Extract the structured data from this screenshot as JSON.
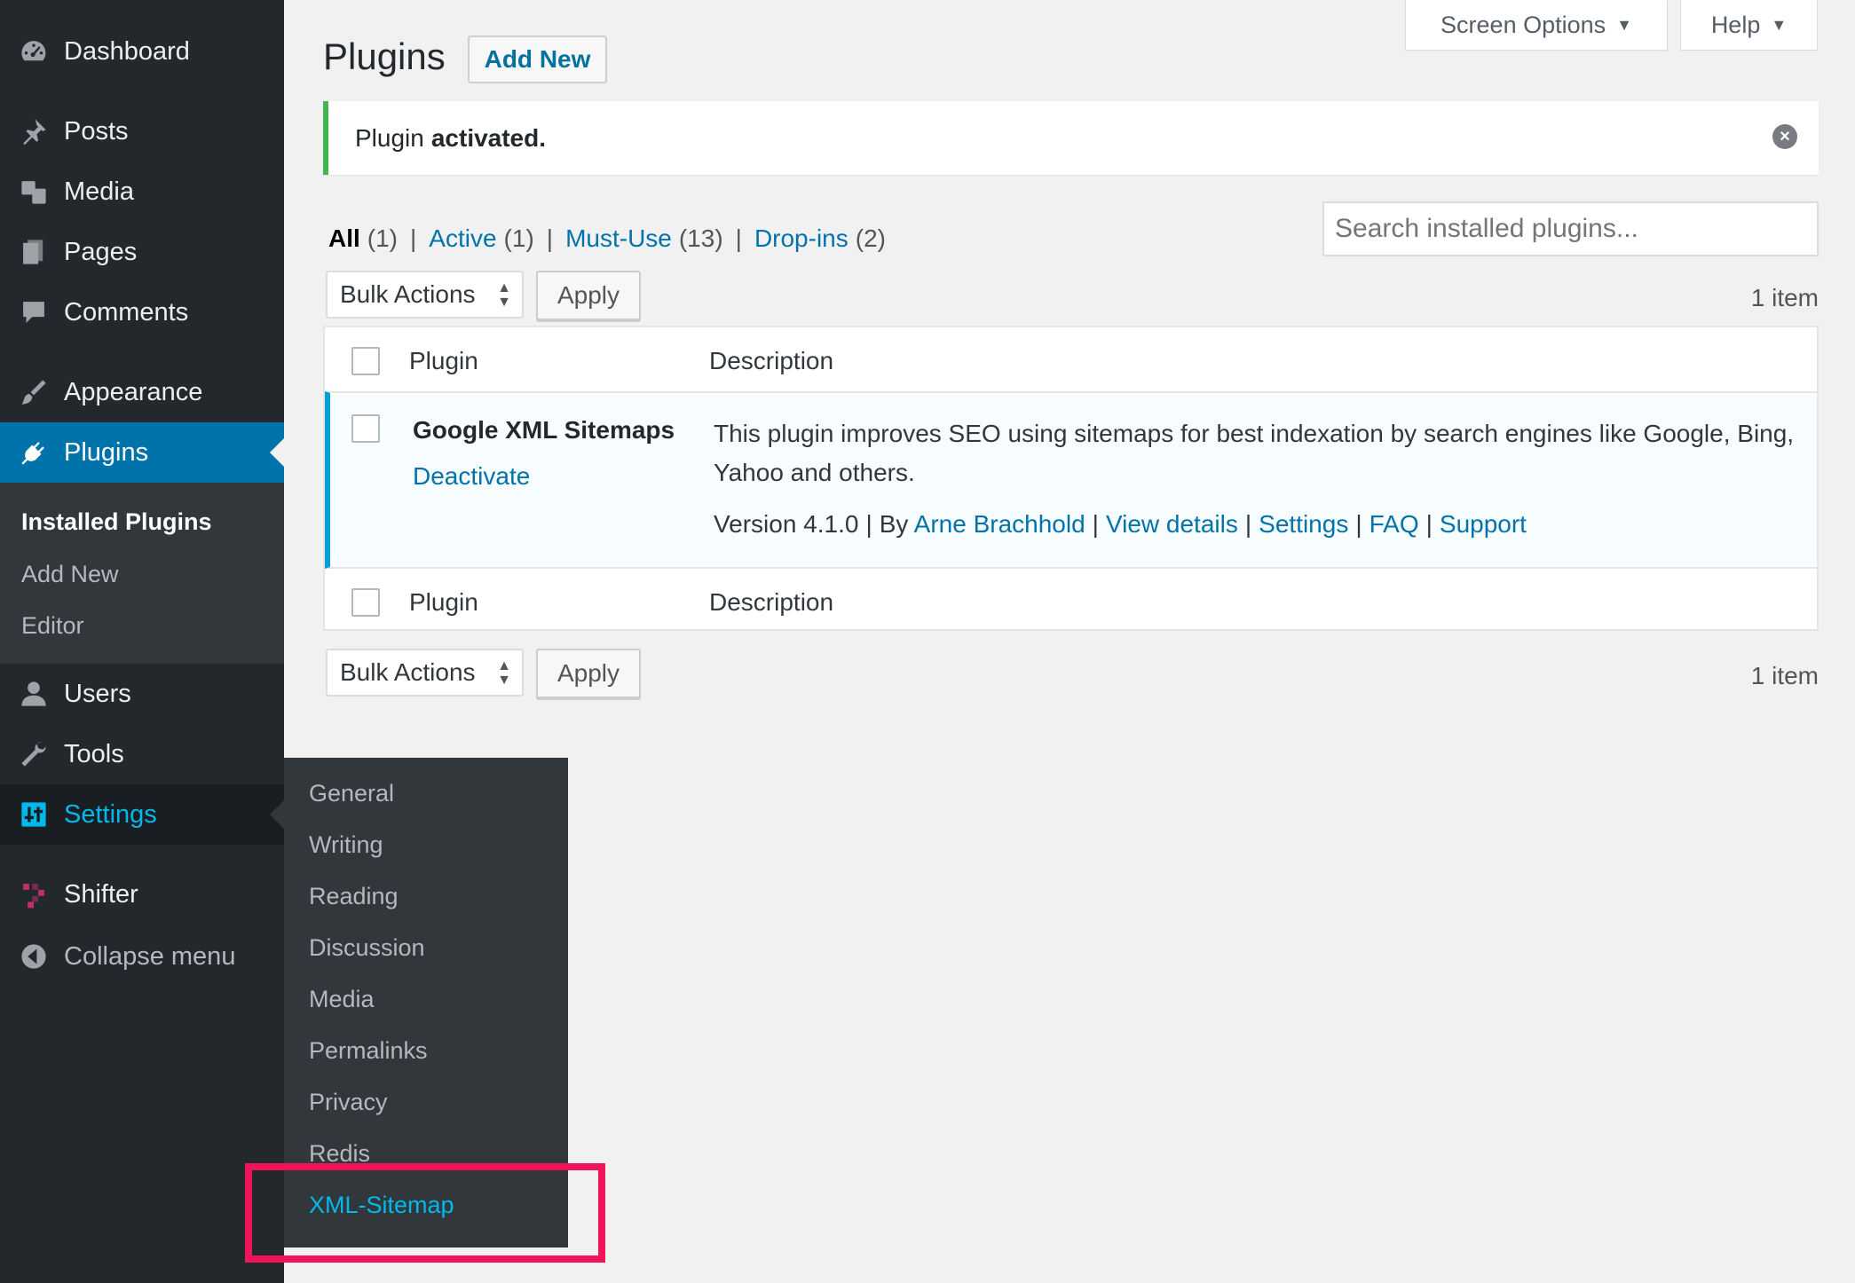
{
  "sidebar": {
    "menu": [
      {
        "label": "Dashboard",
        "icon": "dashboard-icon"
      },
      {
        "label": "Posts",
        "icon": "pin-icon"
      },
      {
        "label": "Media",
        "icon": "media-icon"
      },
      {
        "label": "Pages",
        "icon": "pages-icon"
      },
      {
        "label": "Comments",
        "icon": "comment-icon"
      },
      {
        "label": "Appearance",
        "icon": "paintbrush-icon"
      },
      {
        "label": "Plugins",
        "icon": "plugin-icon"
      },
      {
        "label": "Users",
        "icon": "user-icon"
      },
      {
        "label": "Tools",
        "icon": "wrench-icon"
      },
      {
        "label": "Settings",
        "icon": "sliders-icon"
      },
      {
        "label": "Shifter",
        "icon": "shifter-icon"
      },
      {
        "label": "Collapse menu",
        "icon": "collapse-icon"
      }
    ],
    "plugins_submenu": [
      "Installed Plugins",
      "Add New",
      "Editor"
    ],
    "settings_flyout": [
      "General",
      "Writing",
      "Reading",
      "Discussion",
      "Media",
      "Permalinks",
      "Privacy",
      "Redis",
      "XML-Sitemap"
    ]
  },
  "header": {
    "screen_options": "Screen Options",
    "help": "Help",
    "title": "Plugins",
    "add_new": "Add New"
  },
  "notice": {
    "text": "Plugin",
    "strong": "activated."
  },
  "filters": {
    "all": "All",
    "all_count": "(1)",
    "active": "Active",
    "active_count": "(1)",
    "mustuse": "Must-Use",
    "mustuse_count": "(13)",
    "dropins": "Drop-ins",
    "dropins_count": "(2)"
  },
  "search": {
    "placeholder": "Search installed plugins..."
  },
  "bulk": {
    "label": "Bulk Actions",
    "apply": "Apply",
    "count": "1 item"
  },
  "table": {
    "col_plugin": "Plugin",
    "col_description": "Description",
    "rows": [
      {
        "name": "Google XML Sitemaps",
        "action": "Deactivate",
        "description": "This plugin improves SEO using sitemaps for best indexation by search engines like Google, Bing, Yahoo and others.",
        "version": "Version 4.1.0",
        "by": "By",
        "author": "Arne Brachhold",
        "links": [
          "View details",
          "Settings",
          "FAQ",
          "Support"
        ]
      }
    ]
  },
  "colors": {
    "sidebar_bg": "#23282d",
    "accent": "#0073aa",
    "hover": "#00b9eb",
    "success": "#46b450",
    "highlight_box": "#f0145a"
  }
}
